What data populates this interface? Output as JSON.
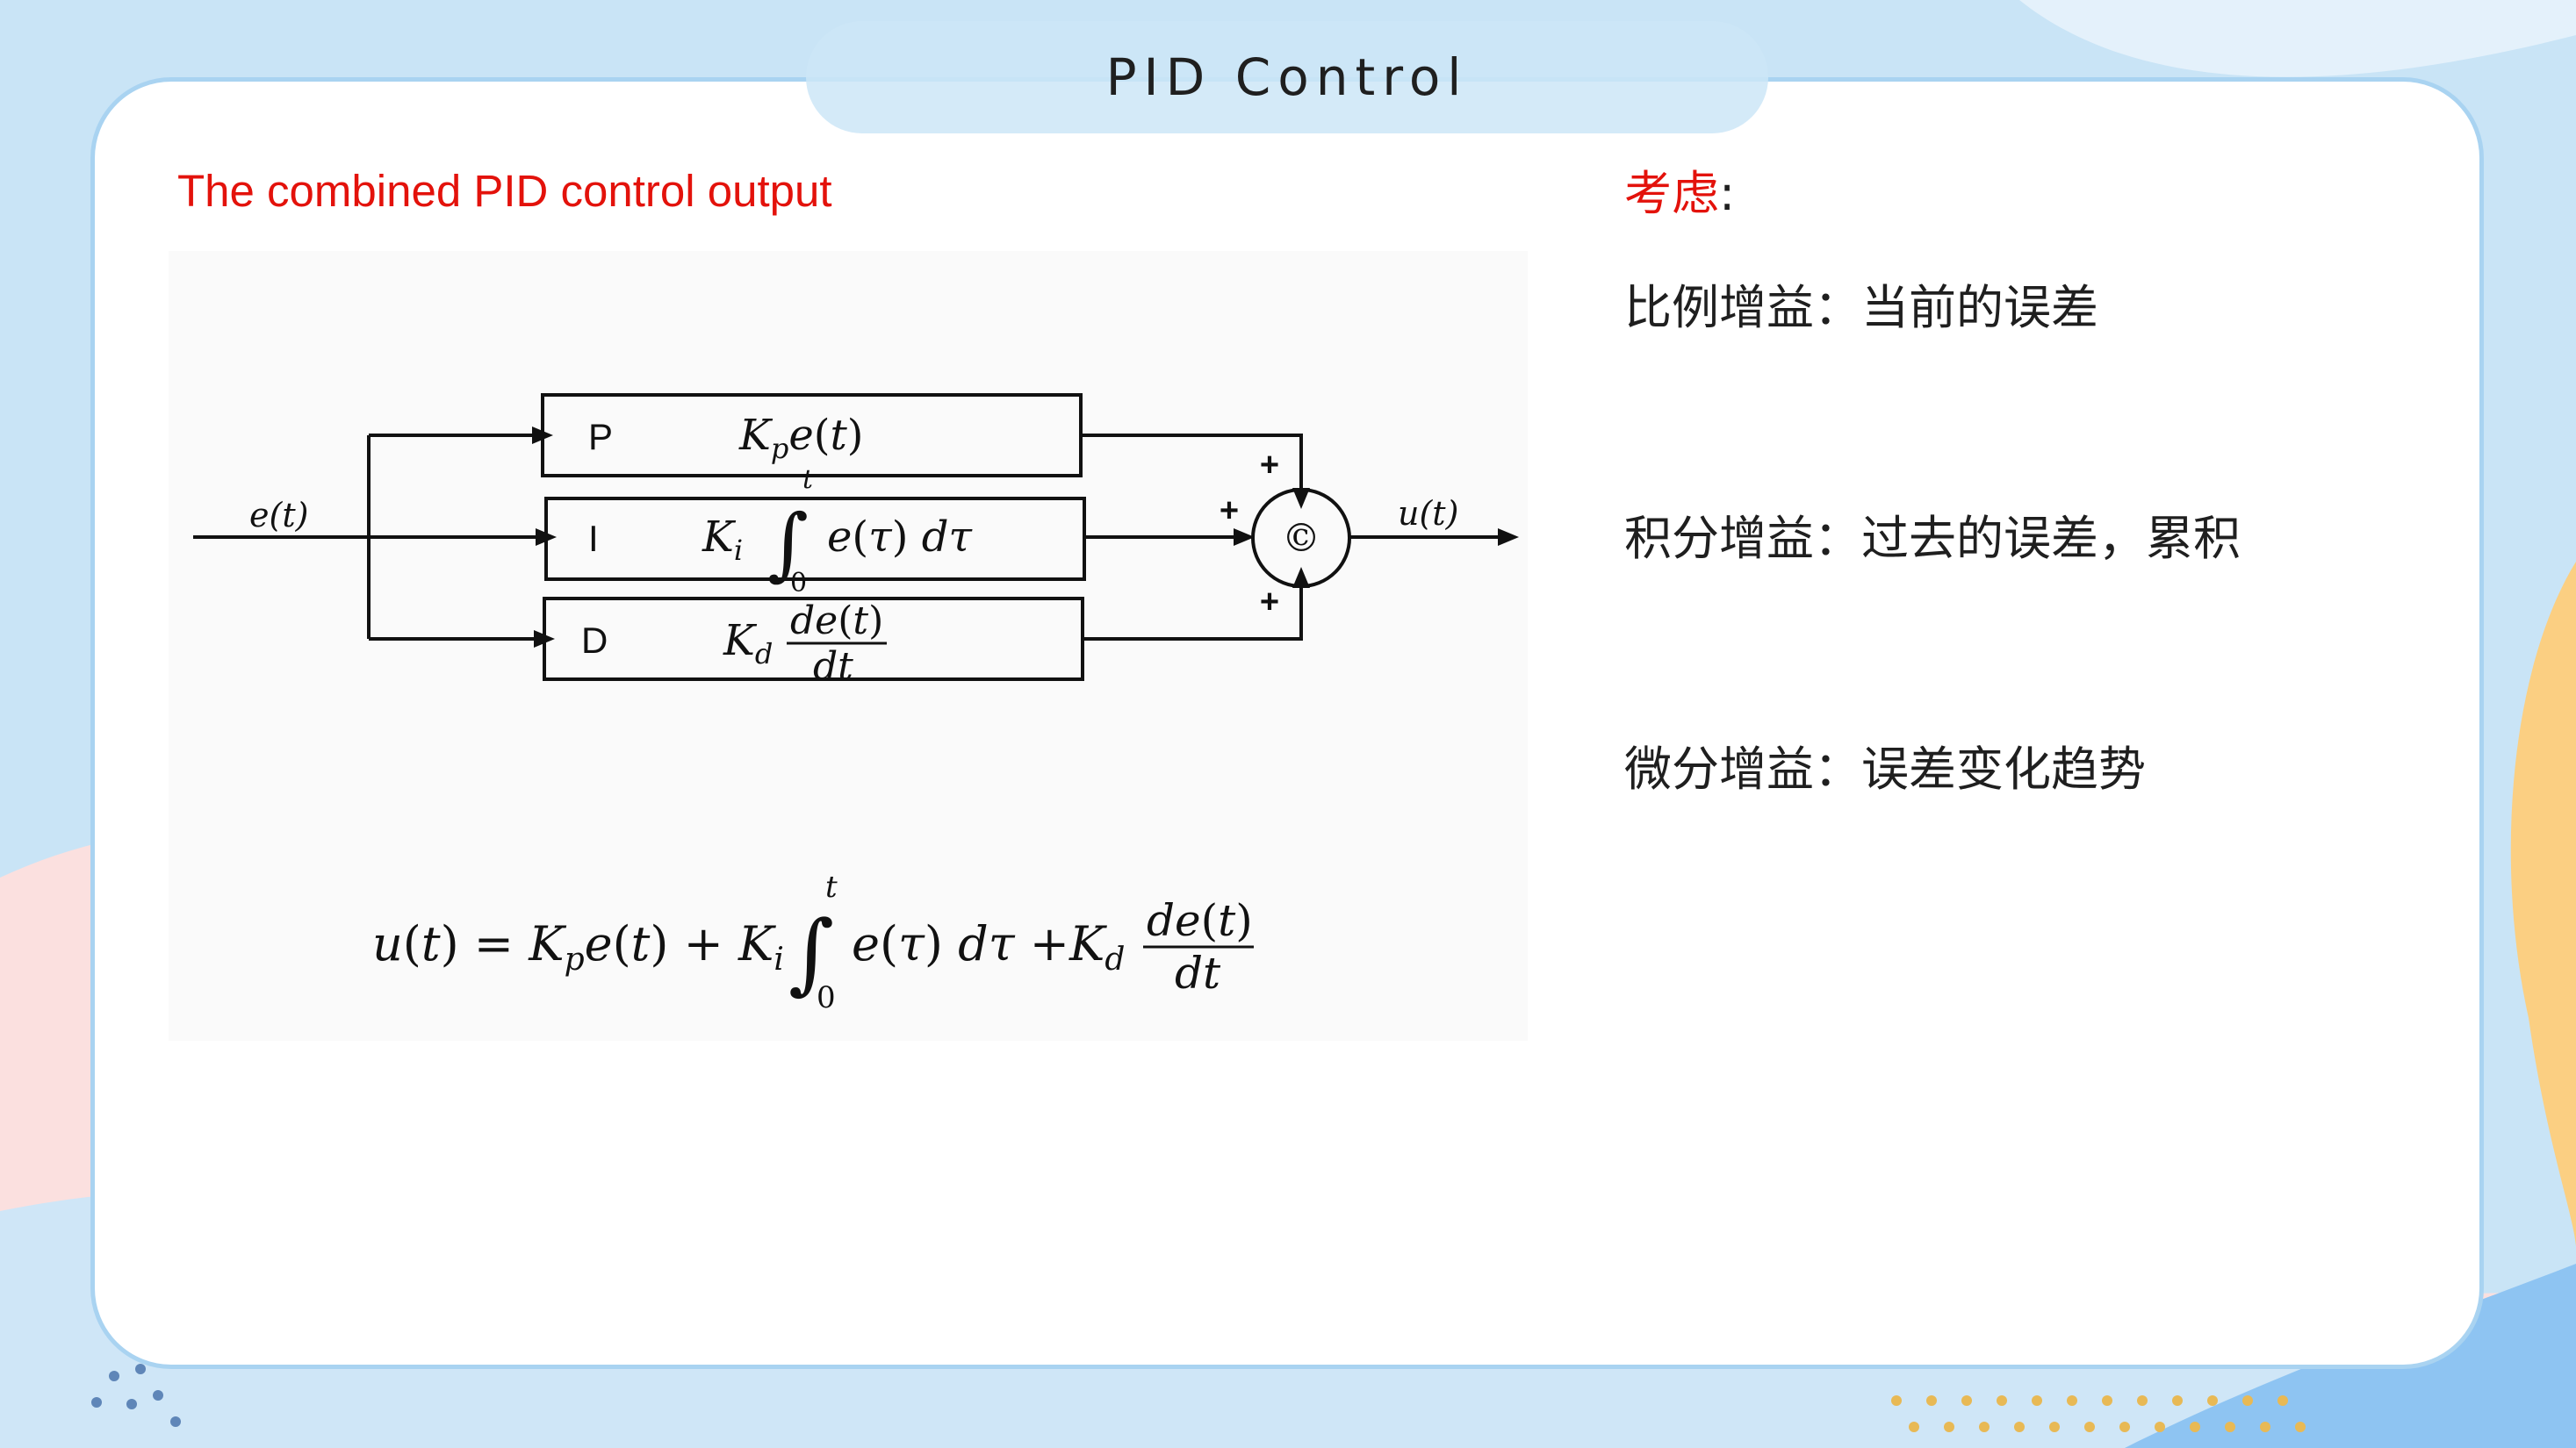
{
  "title": "PID Control",
  "subtitle": "The combined PID control output",
  "diagram": {
    "input_signal": "e(t)",
    "output_signal": "u(t)",
    "blocks": [
      {
        "label": "P",
        "expression": "Kpe(t)"
      },
      {
        "label": "I",
        "expression": "Ki∫0t e(τ) dτ"
      },
      {
        "label": "D",
        "expression": "Kd de(t)/dt"
      }
    ],
    "sum_symbol": "©",
    "sum_signs": [
      "+",
      "+",
      "+"
    ],
    "equation": "u(t) = Kpe(t) + Ki∫0t e(τ) dτ +Kd de(t)/dt"
  },
  "notes": {
    "heading": "考虑",
    "heading_colon": ":",
    "items": [
      "比例增益：当前的误差",
      "积分增益：过去的误差，累积",
      "微分增益：误差变化趋势"
    ]
  },
  "colors": {
    "accent_red": "#e3120b",
    "card_border": "#a9d3f1",
    "background_blue": "#c9e4f6",
    "background_pink": "#fbe0df",
    "background_orange": "#fbcf82"
  }
}
